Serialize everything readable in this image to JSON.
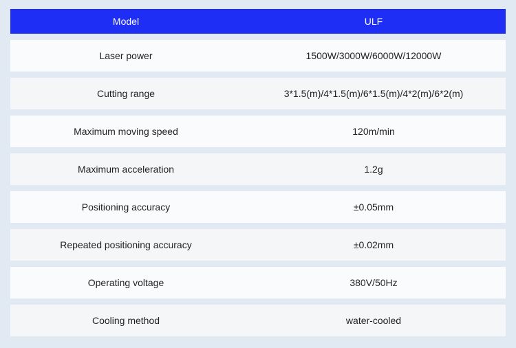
{
  "header": {
    "label": "Model",
    "value": "ULF"
  },
  "rows": [
    {
      "label": "Laser power",
      "value": "1500W/3000W/6000W/12000W"
    },
    {
      "label": "Cutting range",
      "value": "3*1.5(m)/4*1.5(m)/6*1.5(m)/4*2(m)/6*2(m)"
    },
    {
      "label": "Maximum moving speed",
      "value": "120m/min"
    },
    {
      "label": "Maximum acceleration",
      "value": "1.2g"
    },
    {
      "label": "Positioning accuracy",
      "value": "±0.05mm"
    },
    {
      "label": "Repeated positioning accuracy",
      "value": "±0.02mm"
    },
    {
      "label": "Operating voltage",
      "value": "380V/50Hz"
    },
    {
      "label": "Cooling method",
      "value": "water-cooled"
    }
  ],
  "colors": {
    "header_bg": "#1e2ef5",
    "page_bg": "#e1e9f2",
    "row_bg": "#fafbfc"
  }
}
